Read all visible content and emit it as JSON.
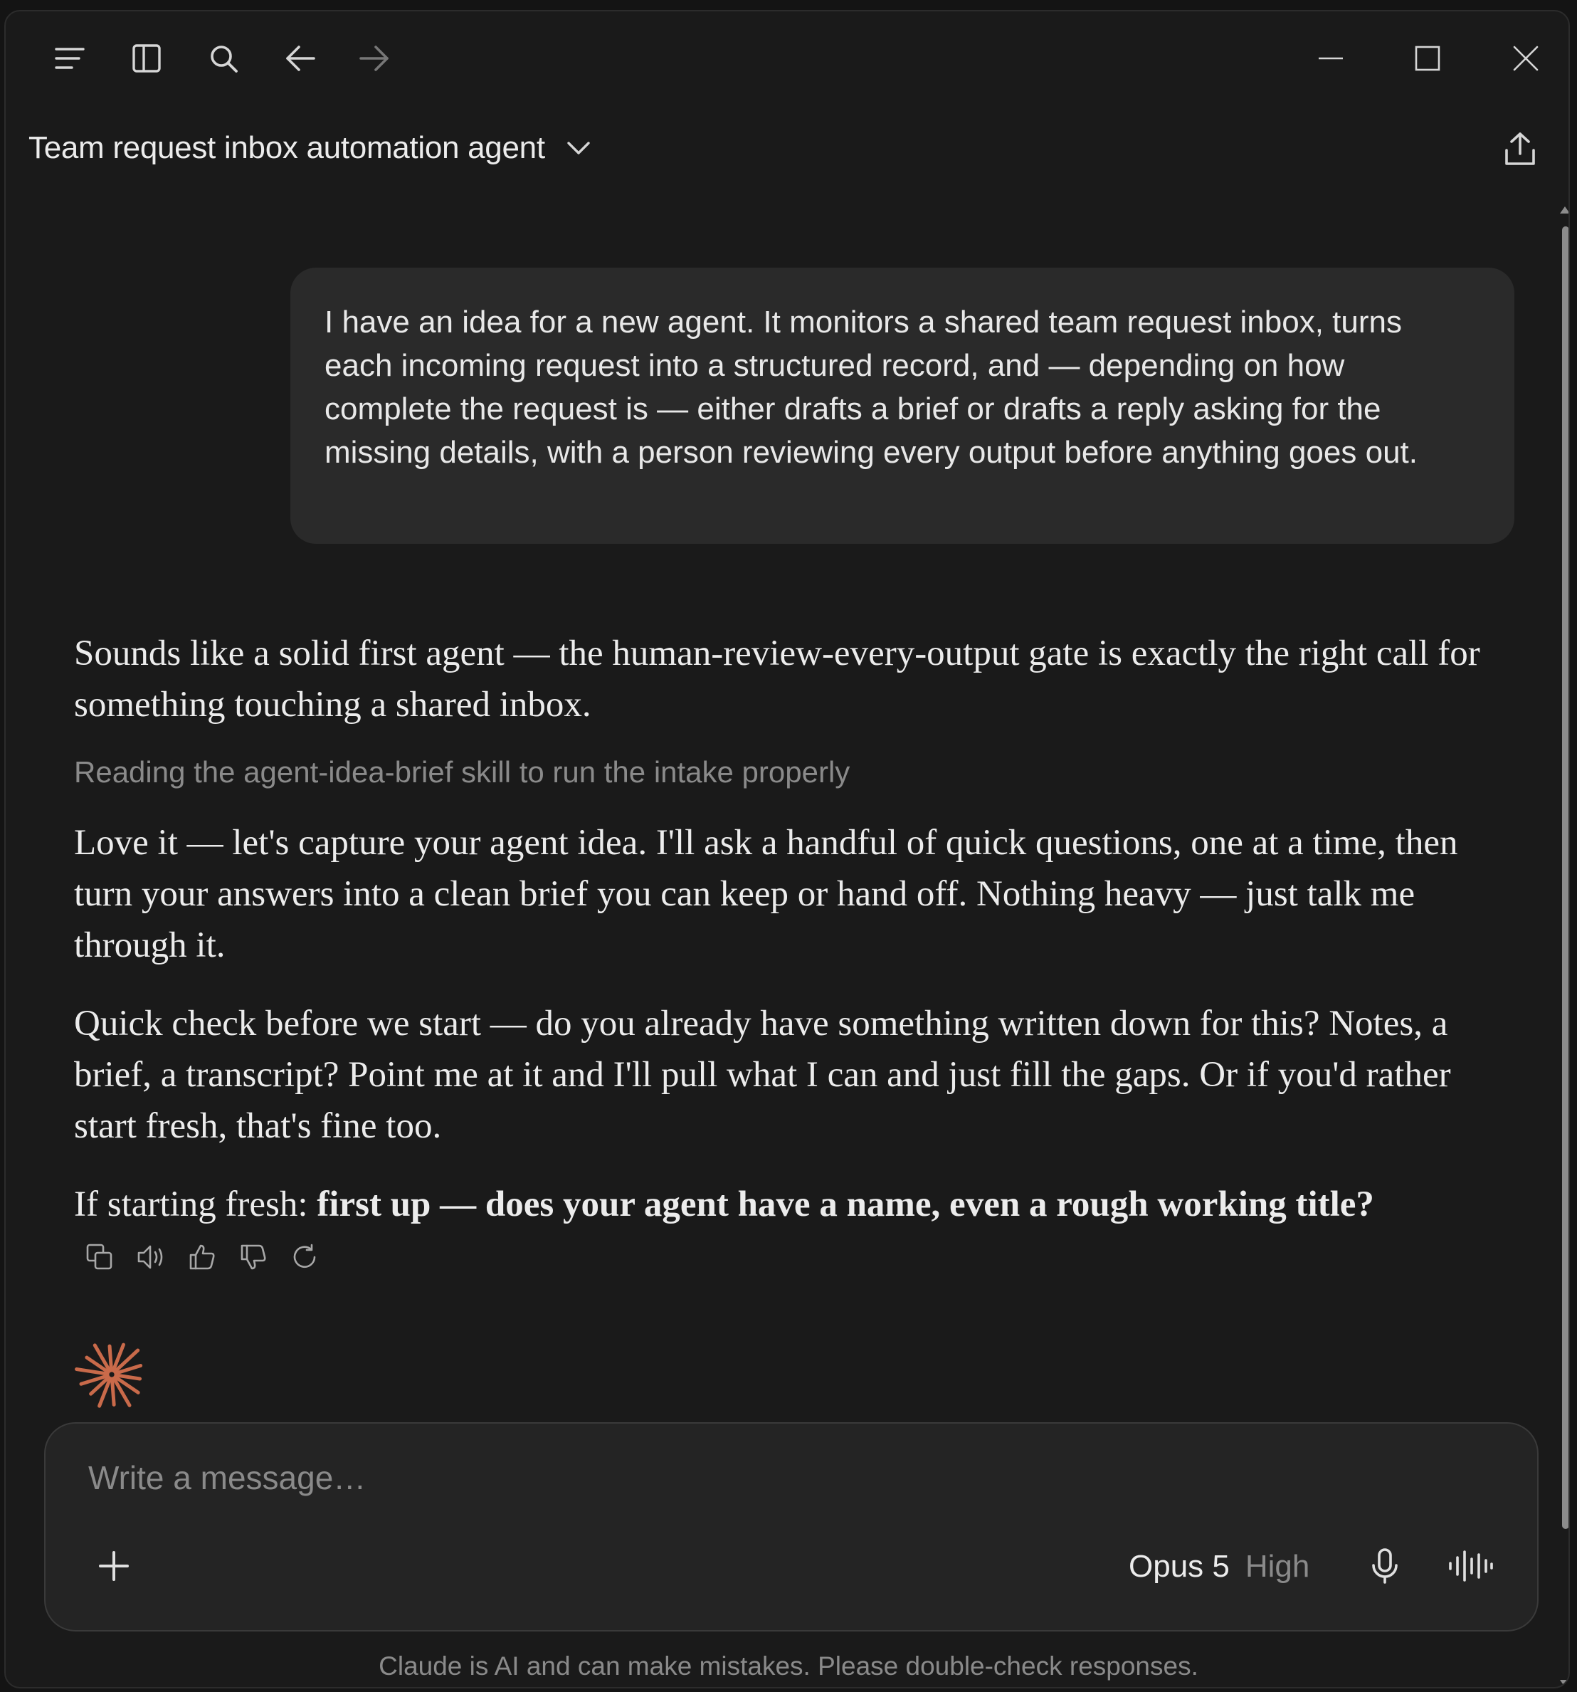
{
  "header": {
    "conversation_title": "Team request inbox automation agent"
  },
  "user_message": {
    "text": "I have an idea for a new agent. It monitors a shared team request inbox, turns each incoming request into a structured record, and — depending on how complete the request is — either drafts a brief or drafts a reply asking for the missing details, with a person reviewing every output before anything goes out."
  },
  "assistant_message": {
    "intro": "Sounds like a solid first agent — the human-review-every-output gate is exactly the right call for something touching a shared inbox.",
    "status": "Reading the agent-idea-brief skill to run the intake properly",
    "para1": "Love it — let's capture your agent idea. I'll ask a handful of quick questions, one at a time, then turn your answers into a clean brief you can keep or hand off. Nothing heavy — just talk me through it.",
    "para2": "Quick check before we start — do you already have something written down for this? Notes, a brief, a transcript? Point me at it and I'll pull what I can and just fill the gaps. Or if you'd rather start fresh, that's fine too.",
    "para3_prefix": "If starting fresh: ",
    "para3_bold": "first up — does your agent have a name, even a rough working title?"
  },
  "composer": {
    "placeholder": "Write a message…",
    "model_name": "Opus 5",
    "model_effort": "High"
  },
  "footer": {
    "disclaimer": "Claude is AI and can make mistakes. Please double-check responses."
  },
  "colors": {
    "accent_spark": "#c96a4a",
    "background": "#1a1a1a",
    "bubble": "#2a2a2a"
  }
}
